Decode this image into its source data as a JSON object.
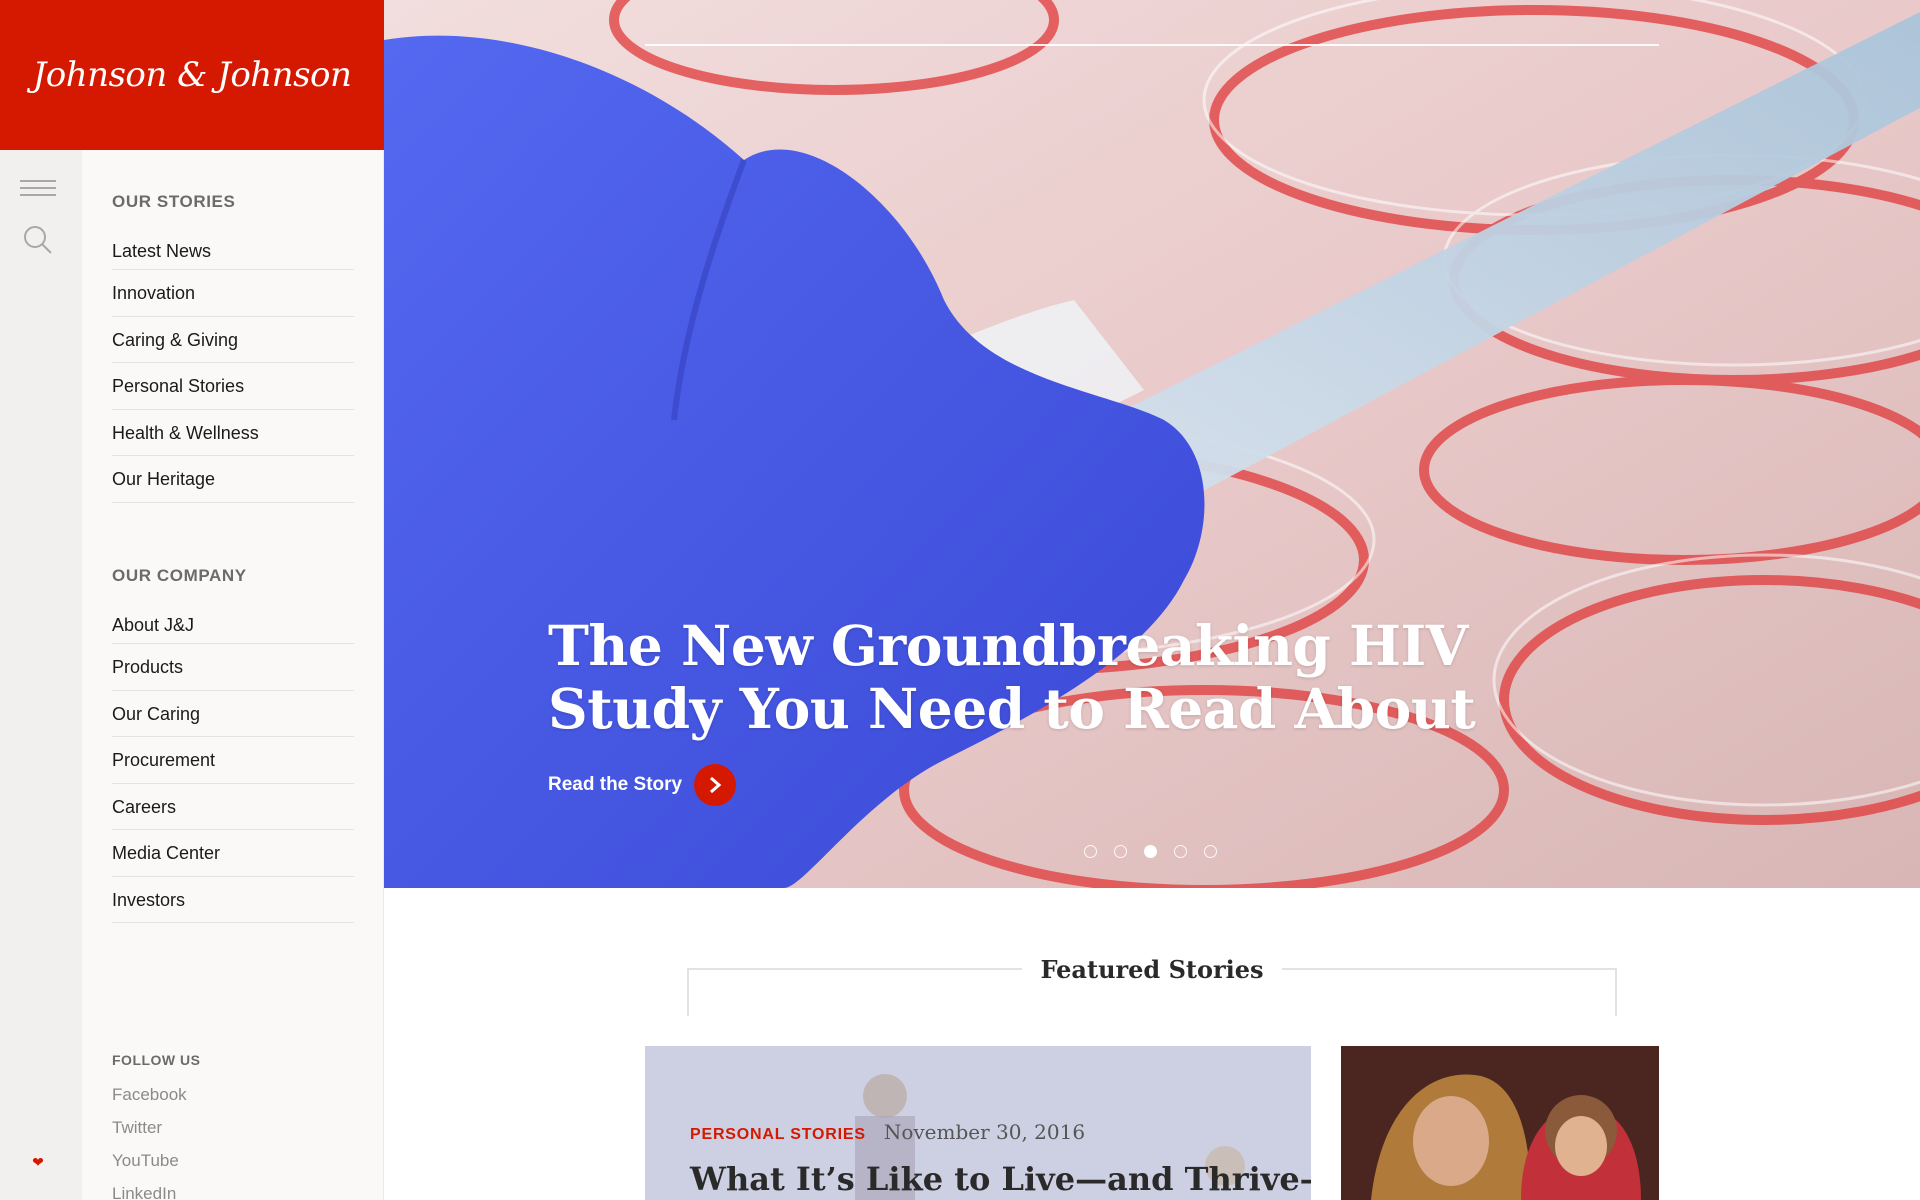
{
  "brand": {
    "logo_text": "Johnson & Johnson",
    "color": "#d51900"
  },
  "rail": {
    "icons": [
      "menu-icon",
      "search-icon",
      "heart-icon"
    ]
  },
  "nav": {
    "stories_heading": "OUR STORIES",
    "stories": [
      "Latest News",
      "Innovation",
      "Caring & Giving",
      "Personal Stories",
      "Health & Wellness",
      "Our Heritage"
    ],
    "company_heading": "OUR COMPANY",
    "company": [
      "About J&J",
      "Products",
      "Our Caring",
      "Procurement",
      "Careers",
      "Media Center",
      "Investors"
    ],
    "follow_heading": "FOLLOW US",
    "follow": [
      "Facebook",
      "Twitter",
      "YouTube",
      "LinkedIn"
    ]
  },
  "hero": {
    "title": "The New Groundbreaking HIV Study You Need to Read About",
    "cta_label": "Read the Story",
    "slide_count": 5,
    "active_slide": 3
  },
  "featured": {
    "heading": "Featured Stories",
    "main_story": {
      "category": "PERSONAL STORIES",
      "date": "November 30, 2016",
      "title": "What It’s Like to Live—and Thrive—"
    }
  }
}
